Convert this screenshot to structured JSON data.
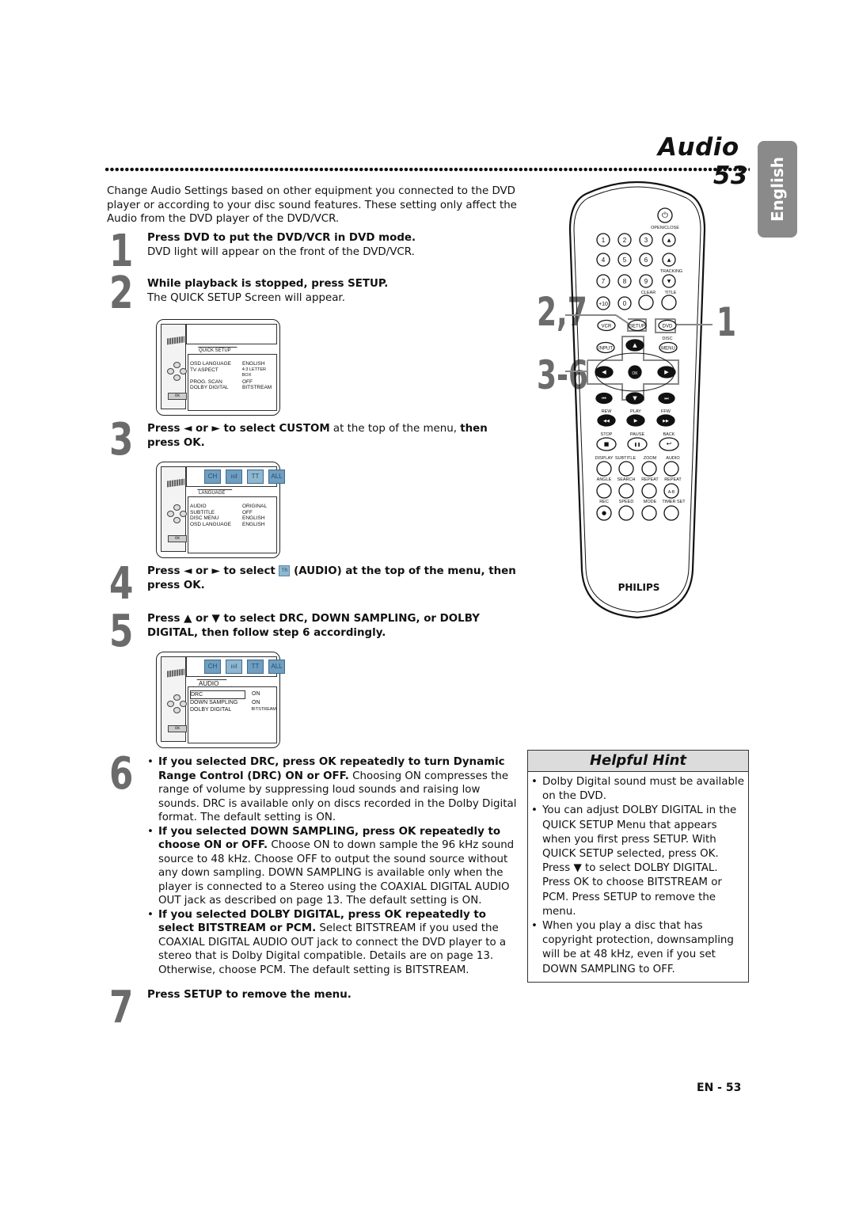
{
  "header": {
    "title": "Audio",
    "page_number": "53",
    "language_tab": "English"
  },
  "intro": "Change Audio Settings based on other equipment you connected to the DVD player or according to your disc sound features. These setting only affect the Audio from the DVD player of the DVD/VCR.",
  "steps": [
    {
      "num": "1",
      "bold": "Press DVD to put the DVD/VCR in DVD mode.",
      "text": "DVD light will appear on the front of the DVD/VCR."
    },
    {
      "num": "2",
      "bold": "While playback is stopped, press SETUP.",
      "text": "The QUICK SETUP Screen will appear."
    },
    {
      "num": "3",
      "bold1": "Press ◄ or ► to select CUSTOM",
      "text1": " at the top of the menu, ",
      "bold2": "then press OK."
    },
    {
      "num": "4",
      "bold1": "Press ◄ or ► to select ",
      "icon_label": "TR",
      "bold2": " (AUDIO) at the top of the menu, then press OK."
    },
    {
      "num": "5",
      "bold": "Press ▲ or ▼ to select DRC, DOWN SAMPLING, or DOLBY DIGITAL, then follow step 6 accordingly."
    },
    {
      "num": "6",
      "bullets": [
        {
          "bold": "If you selected DRC, press OK repeatedly to turn Dynamic Range Control (DRC) ON or OFF.",
          "text": " Choosing ON compresses the range of volume by suppressing loud sounds and raising low sounds. DRC is available only on discs recorded in the Dolby Digital format. The default setting is ON."
        },
        {
          "bold": "If you selected DOWN SAMPLING, press OK repeatedly to choose ON or OFF.",
          "text": " Choose ON to down sample the 96 kHz sound source to 48 kHz. Choose OFF to output the sound source without any down sampling. DOWN SAMPLING is available only when the player is connected to a Stereo using the COAXIAL DIGITAL AUDIO OUT jack as described on page 13. The default setting is ON."
        },
        {
          "bold": "If you selected DOLBY DIGITAL, press OK repeatedly to select BITSTREAM or PCM.",
          "text": " Select BITSTREAM if you used the COAXIAL DIGITAL AUDIO OUT jack to connect the DVD player to a stereo that is Dolby Digital compatible. Details are on page 13. Otherwise, choose PCM. The default setting is BITSTREAM."
        }
      ]
    },
    {
      "num": "7",
      "bold": "Press SETUP to remove the menu."
    }
  ],
  "screens": {
    "quick_setup": {
      "tab": "QUICK SETUP",
      "rows": [
        {
          "k": "OSD LANGUAGE",
          "v": "ENGLISH"
        },
        {
          "k": "TV ASPECT",
          "v": "4:3 LETTER BOX"
        },
        {
          "k": "PROG. SCAN",
          "v": "OFF"
        },
        {
          "k": "DOLBY DIGITAL",
          "v": "BITSTREAM"
        }
      ],
      "ok": "OK"
    },
    "language": {
      "icons": [
        "CH",
        "ıııl",
        "TT",
        "ALL"
      ],
      "tab": "LANGUAGE",
      "rows": [
        {
          "k": "AUDIO",
          "v": "ORIGINAL"
        },
        {
          "k": "SUBTITLE",
          "v": "OFF"
        },
        {
          "k": "DISC MENU",
          "v": "ENGLISH"
        },
        {
          "k": "OSD LANGUAGE",
          "v": "ENGLISH"
        }
      ],
      "ok": "OK"
    },
    "audio": {
      "icons": [
        "CH",
        "ıııl",
        "TT",
        "ALL"
      ],
      "tab": "AUDIO",
      "rows": [
        {
          "k": "DRC",
          "v": "ON"
        },
        {
          "k": "DOWN SAMPLING",
          "v": "ON"
        },
        {
          "k": "DOLBY DIGITAL",
          "v": "BITSTREAM"
        }
      ],
      "ok": "OK"
    }
  },
  "remote": {
    "callouts": {
      "a": "2,7",
      "b": "3-6",
      "c": "1"
    },
    "labels": {
      "open_close": "OPEN/CLOSE",
      "tracking": "TRACKING",
      "clear": "CLEAR",
      "title": "TITLE",
      "n1": "1",
      "n2": "2",
      "n3": "3",
      "n4": "4",
      "n5": "5",
      "n6": "6",
      "n7": "7",
      "n8": "8",
      "n9": "9",
      "n10": "+10",
      "n0": "0",
      "vcr": "VCR",
      "setup": "SETUP",
      "dvd": "DVD",
      "disc": "DISC",
      "input": "INPUT",
      "menu": "MENU",
      "ok": "OK",
      "rew": "REW",
      "play": "PLAY",
      "ffw": "FFW",
      "stop": "STOP",
      "pause": "PAUSE",
      "back": "BACK",
      "display": "DISPLAY",
      "subtitle": "SUBTITLE",
      "zoom": "ZOOM",
      "audio": "AUDIO",
      "angle": "ANGLE",
      "search": "SEARCH",
      "repeat": "REPEAT",
      "repeat2": "REPEAT",
      "ab": "A-B",
      "rec": "REC",
      "speed": "SPEED",
      "mode": "MODE",
      "timer_set": "TIMER SET",
      "brand": "PHILIPS"
    }
  },
  "hint": {
    "title": "Helpful Hint",
    "items": [
      "Dolby Digital sound must be available on the DVD.",
      "You can adjust DOLBY DIGITAL in the QUICK SETUP Menu that appears when you first press SETUP. With QUICK SETUP selected, press OK. Press ▼ to select DOLBY DIGITAL. Press OK to choose BITSTREAM or PCM. Press SETUP to remove the menu.",
      "When you play a disc that has copyright protection, downsampling will be at 48 kHz, even if you set DOWN SAMPLING to OFF."
    ]
  },
  "footer": "EN - 53"
}
